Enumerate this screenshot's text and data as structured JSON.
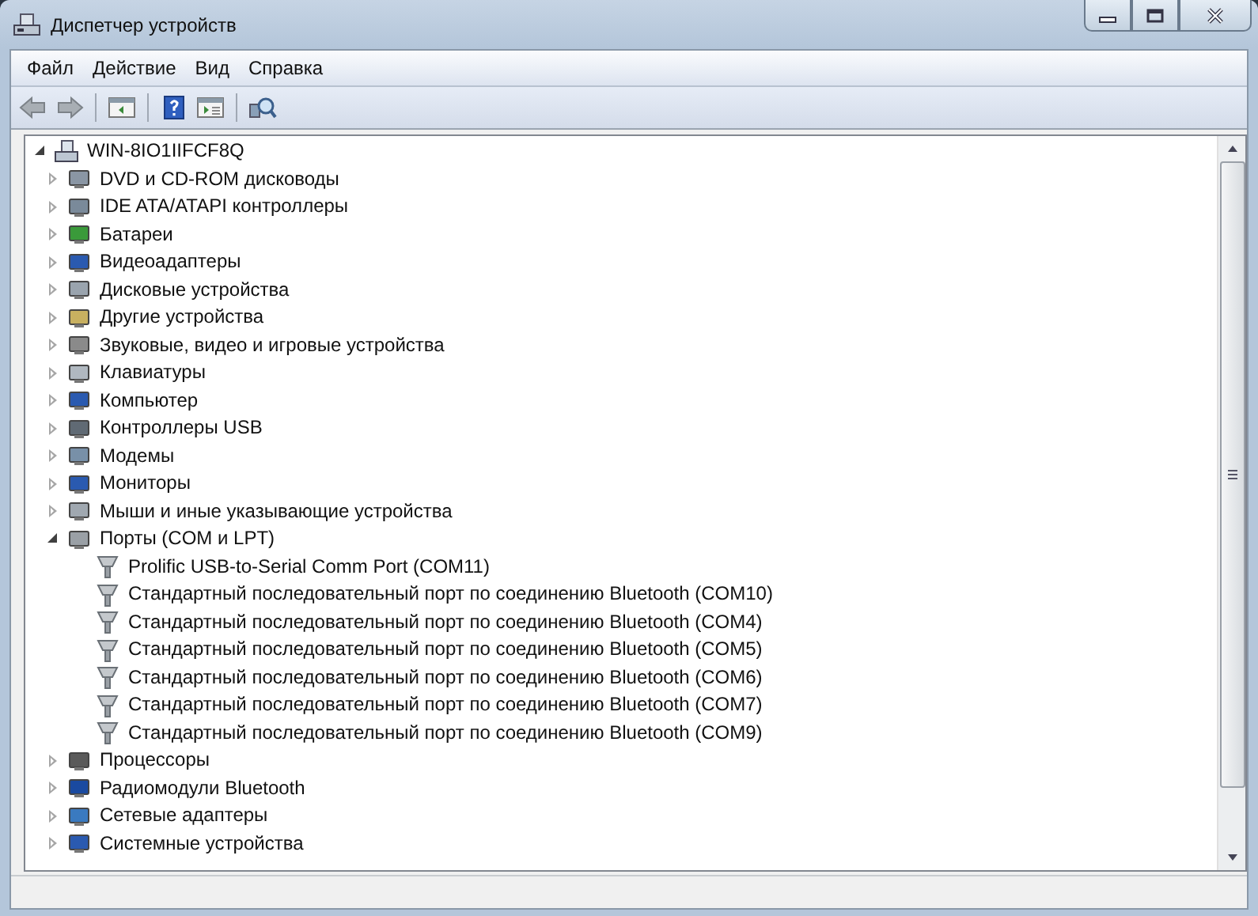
{
  "window": {
    "title": "Диспетчер устройств"
  },
  "menu": [
    "Файл",
    "Действие",
    "Вид",
    "Справка"
  ],
  "tree": {
    "label": "WIN-8IO1IIFCF8Q",
    "expanded": true,
    "children": [
      {
        "label": "DVD и CD-ROM дисководы",
        "expanded": false
      },
      {
        "label": "IDE ATA/ATAPI контроллеры",
        "expanded": false
      },
      {
        "label": "Батареи",
        "expanded": false
      },
      {
        "label": "Видеоадаптеры",
        "expanded": false
      },
      {
        "label": "Дисковые устройства",
        "expanded": false
      },
      {
        "label": "Другие устройства",
        "expanded": false
      },
      {
        "label": "Звуковые, видео и игровые устройства",
        "expanded": false
      },
      {
        "label": "Клавиатуры",
        "expanded": false
      },
      {
        "label": "Компьютер",
        "expanded": false
      },
      {
        "label": "Контроллеры USB",
        "expanded": false
      },
      {
        "label": "Модемы",
        "expanded": false
      },
      {
        "label": "Мониторы",
        "expanded": false
      },
      {
        "label": "Мыши и иные указывающие устройства",
        "expanded": false
      },
      {
        "label": "Порты (COM и LPT)",
        "expanded": true,
        "children": [
          {
            "label": "Prolific USB-to-Serial Comm Port (COM11)"
          },
          {
            "label": "Стандартный последовательный порт по соединению Bluetooth (COM10)"
          },
          {
            "label": "Стандартный последовательный порт по соединению Bluetooth (COM4)"
          },
          {
            "label": "Стандартный последовательный порт по соединению Bluetooth (COM5)"
          },
          {
            "label": "Стандартный последовательный порт по соединению Bluetooth (COM6)"
          },
          {
            "label": "Стандартный последовательный порт по соединению Bluetooth (COM7)"
          },
          {
            "label": "Стандартный последовательный порт по соединению Bluetooth (COM9)"
          }
        ]
      },
      {
        "label": "Процессоры",
        "expanded": false
      },
      {
        "label": "Радиомодули Bluetooth",
        "expanded": false
      },
      {
        "label": "Сетевые адаптеры",
        "expanded": false
      },
      {
        "label": "Системные устройства",
        "expanded": false
      }
    ]
  }
}
